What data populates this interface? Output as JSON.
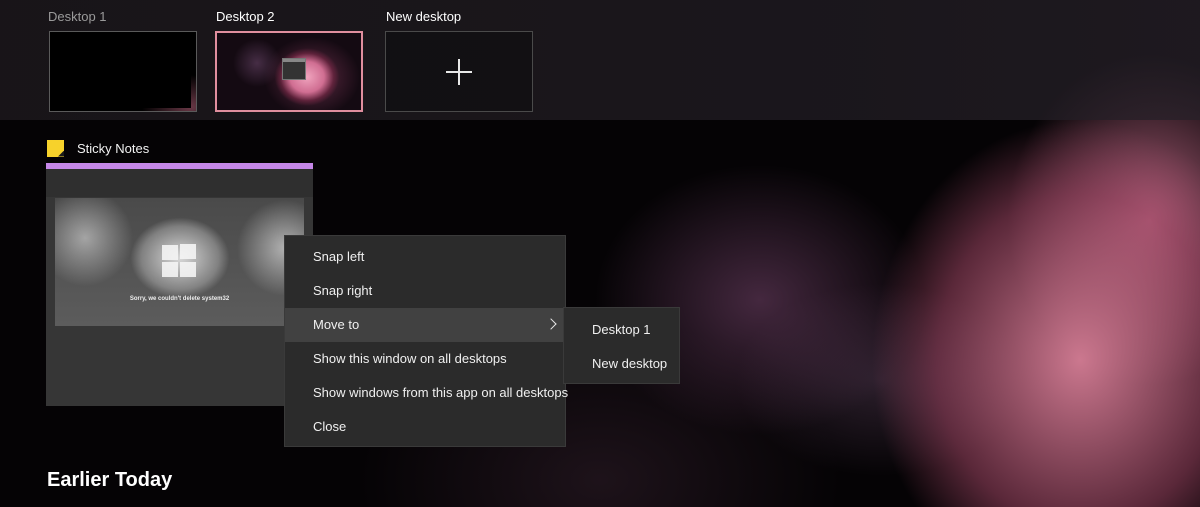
{
  "desktops": [
    {
      "label": "Desktop 1",
      "selected": false
    },
    {
      "label": "Desktop 2",
      "selected": true
    },
    {
      "label": "New desktop",
      "icon": "plus-icon"
    }
  ],
  "window": {
    "app_name": "Sticky Notes",
    "app_icon": "sticky-notes-icon",
    "accent_color": "#c687e8",
    "preview_text": "Sorry, we couldn't delete system32"
  },
  "context_menu": {
    "items": [
      {
        "label": "Snap left"
      },
      {
        "label": "Snap right"
      },
      {
        "label": "Move to",
        "has_submenu": true,
        "active": true
      },
      {
        "label": "Show this window on all desktops"
      },
      {
        "label": "Show windows from this app on all desktops"
      },
      {
        "label": "Close"
      }
    ],
    "submenu": [
      {
        "label": "Desktop 1"
      },
      {
        "label": "New desktop"
      }
    ]
  },
  "timeline": {
    "heading": "Earlier Today"
  },
  "colors": {
    "selected_desktop_border": "#e08e9e",
    "menu_background": "#2b2b2b",
    "menu_active": "#414141"
  }
}
